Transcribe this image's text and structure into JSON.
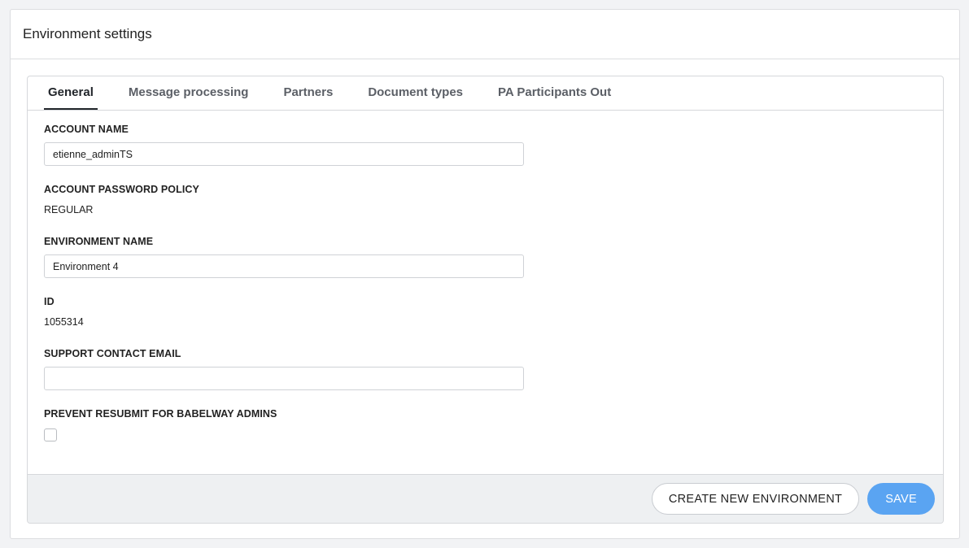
{
  "panel": {
    "title": "Environment settings"
  },
  "tabs": [
    {
      "label": "General"
    },
    {
      "label": "Message processing"
    },
    {
      "label": "Partners"
    },
    {
      "label": "Document types"
    },
    {
      "label": "PA Participants Out"
    }
  ],
  "form": {
    "account_name": {
      "label": "ACCOUNT NAME",
      "value": "etienne_adminTS"
    },
    "password_policy": {
      "label": "ACCOUNT PASSWORD POLICY",
      "value": "REGULAR"
    },
    "environment_name": {
      "label": "ENVIRONMENT NAME",
      "value": "Environment 4"
    },
    "id": {
      "label": "ID",
      "value": "1055314"
    },
    "support_email": {
      "label": "SUPPORT CONTACT EMAIL",
      "value": ""
    },
    "prevent_resubmit": {
      "label": "PREVENT RESUBMIT FOR BABELWAY ADMINS",
      "checked": false
    }
  },
  "footer": {
    "create_label": "CREATE NEW ENVIRONMENT",
    "save_label": "SAVE"
  },
  "colors": {
    "primary": "#5aa4f2",
    "background": "#f2f3f5"
  }
}
